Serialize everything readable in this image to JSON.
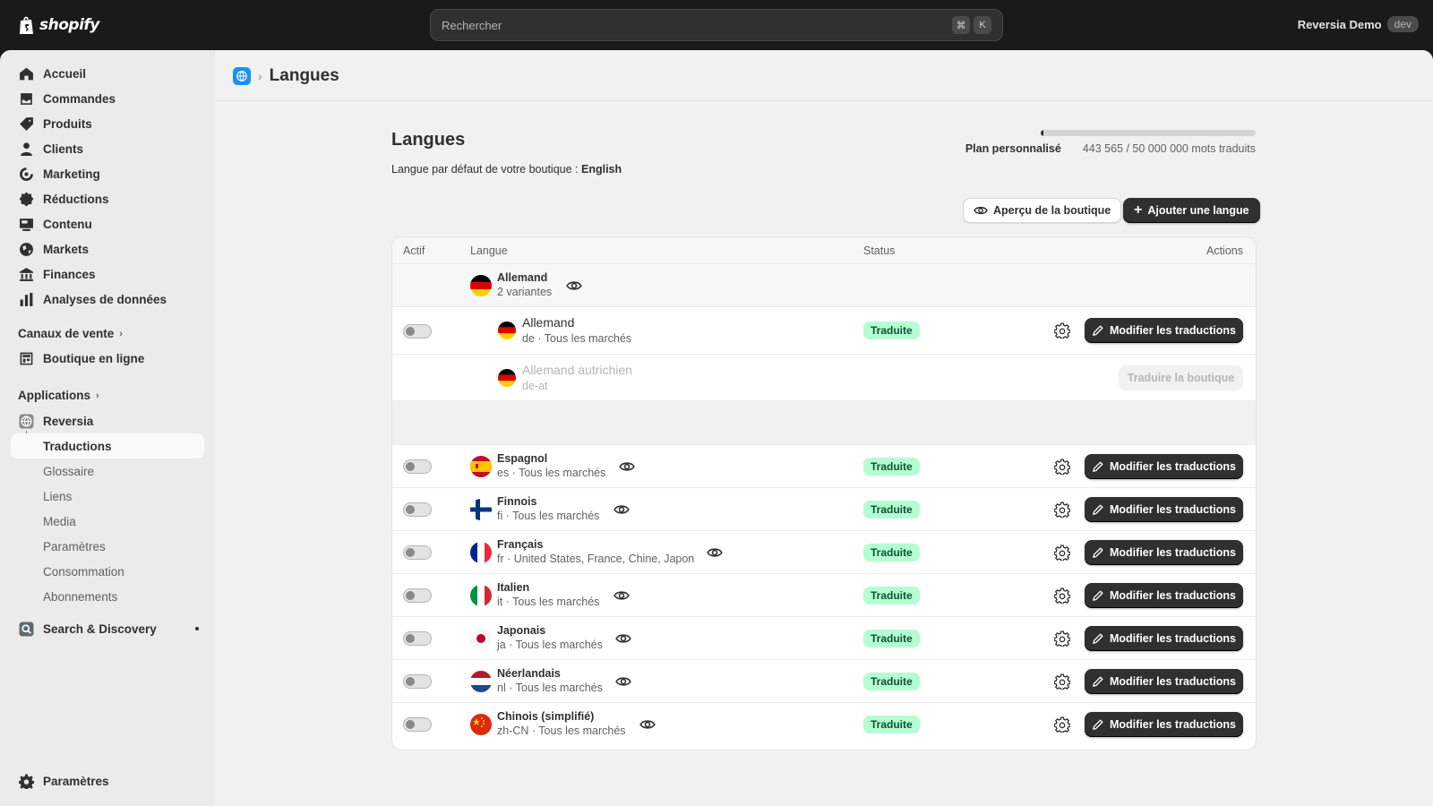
{
  "topbar": {
    "logo_text": "shopify",
    "search_placeholder": "Rechercher",
    "shortcut_keys": [
      "⌘",
      "K"
    ],
    "store_name": "Reversia Demo",
    "store_badge": "dev"
  },
  "sidebar": {
    "items": [
      {
        "label": "Accueil",
        "icon": "home-icon"
      },
      {
        "label": "Commandes",
        "icon": "inbox-icon"
      },
      {
        "label": "Produits",
        "icon": "tag-icon"
      },
      {
        "label": "Clients",
        "icon": "person-icon"
      },
      {
        "label": "Marketing",
        "icon": "target-icon"
      },
      {
        "label": "Réductions",
        "icon": "discount-icon"
      },
      {
        "label": "Contenu",
        "icon": "content-icon"
      },
      {
        "label": "Markets",
        "icon": "globe-icon"
      },
      {
        "label": "Finances",
        "icon": "bank-icon"
      },
      {
        "label": "Analyses de données",
        "icon": "chart-icon"
      }
    ],
    "sales_channels_title": "Canaux de vente",
    "online_store": "Boutique en ligne",
    "apps_title": "Applications",
    "app_name": "Reversia",
    "app_subitems": [
      "Traductions",
      "Glossaire",
      "Liens",
      "Media",
      "Paramètres",
      "Consommation",
      "Abonnements"
    ],
    "search_discovery": "Search & Discovery",
    "settings": "Paramètres"
  },
  "main": {
    "breadcrumb_title": "Langues",
    "page_title": "Langues",
    "default_lang_prefix": "Langue par défaut de votre boutique : ",
    "default_lang": "English",
    "plan_label": "Plan personnalisé",
    "usage_text": "443 565 / 50 000 000 mots traduits",
    "usage_fraction": 0.0089,
    "preview_button": "Aperçu de la boutique",
    "add_button": "Ajouter une langue",
    "table": {
      "headers": {
        "active": "Actif",
        "language": "Langue",
        "status": "Status",
        "actions": "Actions"
      },
      "group": {
        "name": "Allemand",
        "sub": "2 variantes"
      },
      "variants": [
        {
          "name": "Allemand",
          "sub": "de · Tous les marchés",
          "status": "Traduite",
          "action": "Modifier les traductions"
        },
        {
          "name": "Allemand autrichien",
          "sub": "de-at",
          "action": "Traduire la boutique"
        }
      ],
      "rows": [
        {
          "name": "Espagnol",
          "sub": "es · Tous les marchés",
          "status": "Traduite",
          "action": "Modifier les traductions",
          "flag": "es"
        },
        {
          "name": "Finnois",
          "sub": "fi · Tous les marchés",
          "status": "Traduite",
          "action": "Modifier les traductions",
          "flag": "fi"
        },
        {
          "name": "Français",
          "sub": "fr · United States, France, Chine, Japon",
          "status": "Traduite",
          "action": "Modifier les traductions",
          "flag": "fr"
        },
        {
          "name": "Italien",
          "sub": "it · Tous les marchés",
          "status": "Traduite",
          "action": "Modifier les traductions",
          "flag": "it"
        },
        {
          "name": "Japonais",
          "sub": "ja · Tous les marchés",
          "status": "Traduite",
          "action": "Modifier les traductions",
          "flag": "ja"
        },
        {
          "name": "Néerlandais",
          "sub": "nl · Tous les marchés",
          "status": "Traduite",
          "action": "Modifier les traductions",
          "flag": "nl"
        },
        {
          "name": "Chinois (simplifié)",
          "sub": "zh-CN · Tous les marchés",
          "status": "Traduite",
          "action": "Modifier les traductions",
          "flag": "cn"
        }
      ]
    }
  }
}
